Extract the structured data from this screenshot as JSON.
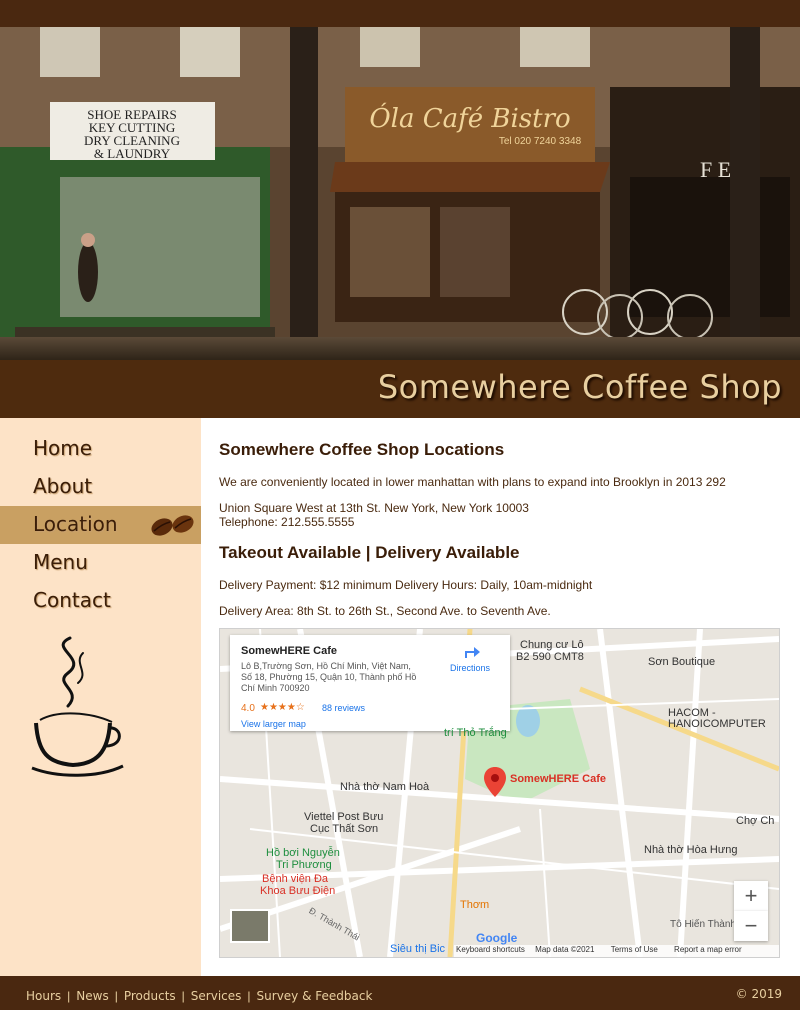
{
  "site": {
    "title": "Somewhere Coffee Shop",
    "brand_color": "#4e2b0e"
  },
  "hero": {
    "shop_sign": "Óla Café Bistro",
    "sign_left_lines": [
      "SHOE REPAIRS",
      "KEY CUTTING",
      "DRY CLEANING",
      "& LAUNDRY"
    ],
    "phone_sign": "Tel 020 7240 3348"
  },
  "nav": {
    "items": [
      {
        "label": "Home"
      },
      {
        "label": "About"
      },
      {
        "label": "Location"
      },
      {
        "label": "Menu"
      },
      {
        "label": "Contact"
      }
    ],
    "active": "Location"
  },
  "main": {
    "heading": "Somewhere Coffee Shop Locations",
    "intro": "We are conveniently located in lower manhattan with plans to expand into Brooklyn in 2013 292",
    "address": "Union Square West at 13th St. New York, New York 10003",
    "telephone": "Telephone: 212.555.5555",
    "takeout_heading": "Takeout Available | Delivery Available",
    "delivery_payment": "Delivery Payment: $12 minimum Delivery Hours:  Daily, 10am-midnight",
    "delivery_area": "Delivery Area: 8th St. to 26th St., Second Ave. to Seventh Ave."
  },
  "map": {
    "place_name": "SomewHERE Cafe",
    "place_address": "Lô B,Trường Sơn, Hồ Chí Minh, Việt Nam, Số 18, Phường 15, Quận 10, Thành phố Hồ Chí Minh 700920",
    "rating": "4.0",
    "stars": "★★★★☆",
    "reviews": "88 reviews",
    "directions": "Directions",
    "larger_map": "View larger map",
    "marker_label": "SomewHERE Cafe",
    "zoom_in": "+",
    "zoom_out": "−",
    "brand": "Google",
    "keyboard": "Keyboard shortcuts",
    "map_data": "Map data ©2021",
    "terms": "Terms of Use",
    "report": "Report a map error",
    "labels": {
      "chung_cu": "Chung cư Lô",
      "b2": "B2 590 CMT8",
      "son_boutique": "Sơn Boutique",
      "hacom": "HACOM -",
      "hanoicomputer": "HANOICOMPUTER",
      "tho_trang": "trí Thỏ Trắng",
      "nam_hoa": "Nhà thờ Nam Hoà",
      "viettel": "Viettel Post Bưu",
      "cuc": "Cục Thất Sơn",
      "ho_boi": "Hồ bơi Nguyễn",
      "tri_phuong": "Tri Phương",
      "benh_vien": "Bệnh viện Đa",
      "khoa": "Khoa Bưu Điện",
      "cho_ch": "Chợ Ch",
      "hoa_hung": "Nhà thờ Hòa Hưng",
      "tham": "Thơm",
      "sieu_thi": "Siêu thị Bic",
      "to_hien_thanh": "Tô Hiến Thành",
      "dien_bien": "Đ. Thành Thái"
    }
  },
  "footer": {
    "links": [
      "Hours",
      "News",
      "Products",
      "Services",
      "Survey & Feedback"
    ],
    "copyright": "© 2019"
  }
}
